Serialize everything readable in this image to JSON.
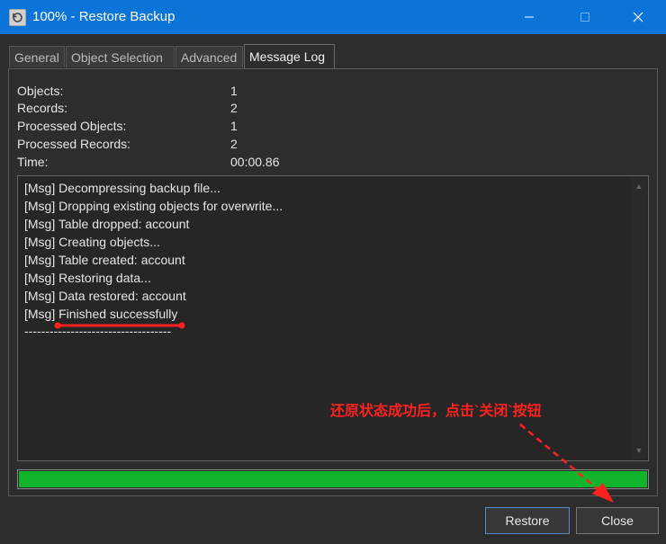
{
  "window": {
    "title": "100% - Restore Backup"
  },
  "tabs": [
    {
      "label": "General",
      "active": false
    },
    {
      "label": "Object Selection",
      "active": false
    },
    {
      "label": "Advanced",
      "active": false
    },
    {
      "label": "Message Log",
      "active": true
    }
  ],
  "stats": [
    {
      "label": "Objects:",
      "value": "1"
    },
    {
      "label": "Records:",
      "value": "2"
    },
    {
      "label": "Processed Objects:",
      "value": "1"
    },
    {
      "label": "Processed Records:",
      "value": "2"
    },
    {
      "label": "Time:",
      "value": "00:00.86"
    }
  ],
  "log": [
    "[Msg] Decompressing backup file...",
    "[Msg] Dropping existing objects for overwrite...",
    "[Msg] Table dropped: account",
    "[Msg] Creating objects...",
    "[Msg] Table created: account",
    "[Msg] Restoring data...",
    "[Msg] Data restored: account",
    "[Msg] Finished successfully",
    "-----------------------------------"
  ],
  "progress": {
    "percent": 100,
    "color": "#10b52c"
  },
  "buttons": {
    "restore": "Restore",
    "close": "Close"
  },
  "annotation": {
    "text": "还原状态成功后，点击`关闭`按钮",
    "color": "#ff2020"
  },
  "colors": {
    "titlebar": "#0a74d9",
    "background": "#2d2d2d"
  }
}
